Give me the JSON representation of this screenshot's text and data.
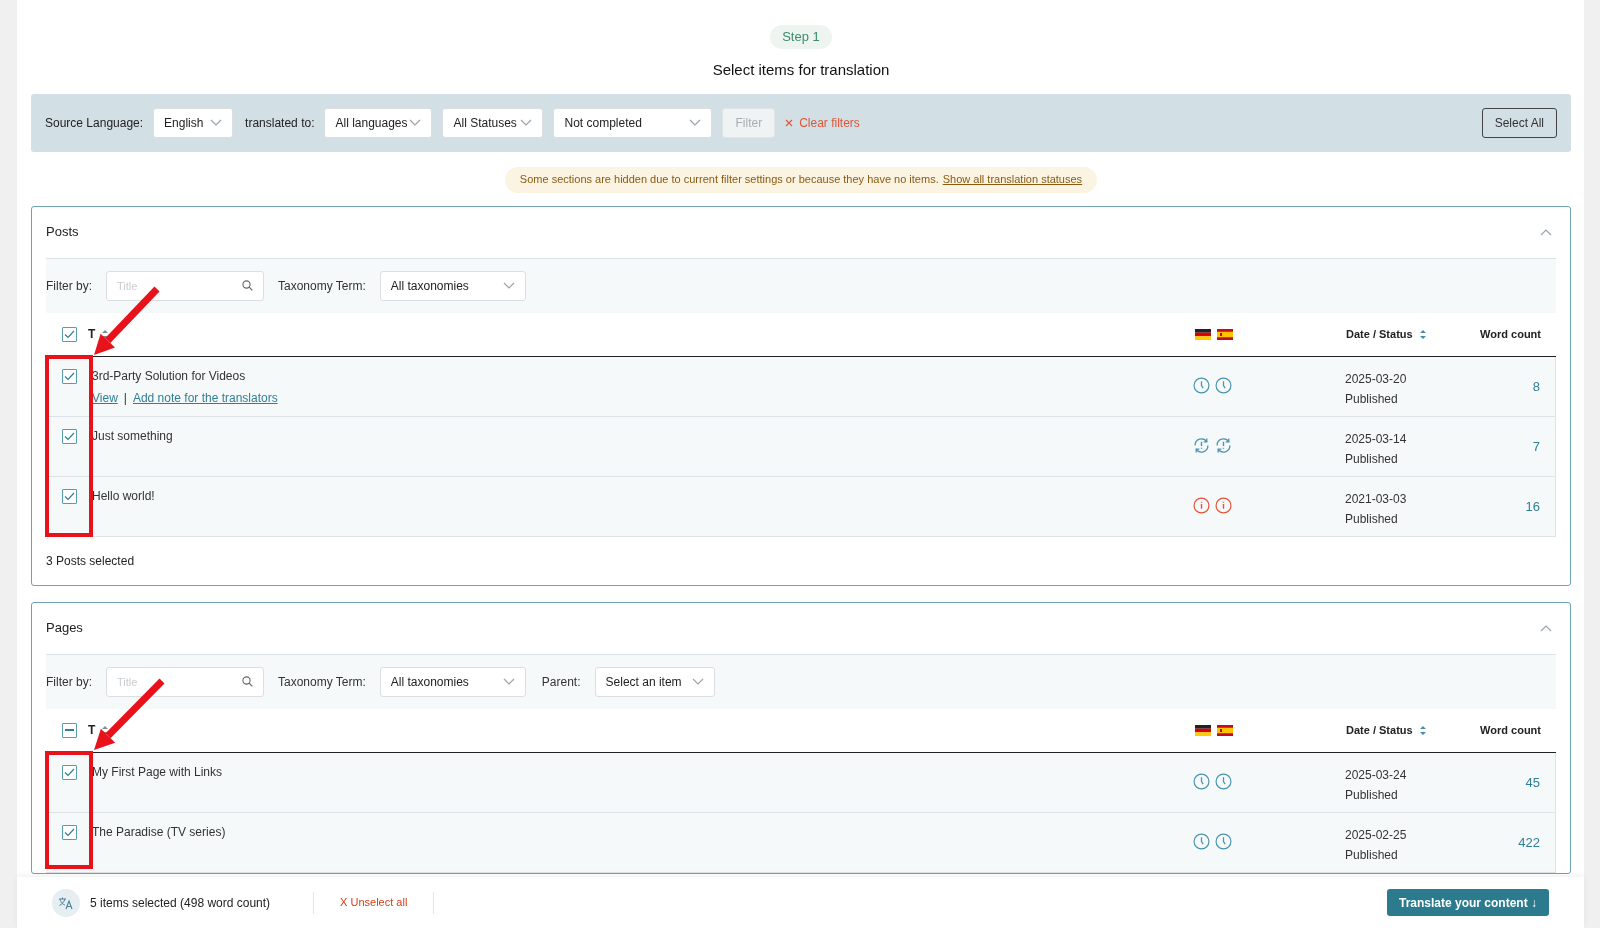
{
  "step": {
    "label": "Step 1",
    "title": "Select items for translation"
  },
  "filter_bar": {
    "source_label": "Source Language:",
    "source_value": "English",
    "translated_label": "translated to:",
    "languages": "All languages",
    "statuses": "All Statuses",
    "completion": "Not completed",
    "filter_button": "Filter",
    "clear": "Clear filters",
    "select_all": "Select All"
  },
  "notice": {
    "text": "Some sections are hidden due to current filter settings or because they have no items.",
    "link": "Show all translation statuses"
  },
  "sections": [
    {
      "title": "Posts",
      "expanded": true,
      "filter_label": "Filter by:",
      "title_placeholder": "Title",
      "taxonomy_label": "Taxonomy Term:",
      "taxonomy_value": "All taxonomies",
      "header_checkbox": {
        "checked": true
      },
      "columns": {
        "title": "T",
        "date": "Date / Status",
        "words": "Word count"
      },
      "languages": [
        {
          "kind": "de"
        },
        {
          "kind": "es"
        }
      ],
      "rows": [
        {
          "title": "3rd-Party Solution for Videos",
          "checked": true,
          "links": [
            "View",
            "Add note for the translators"
          ],
          "link_separator": "|",
          "statuses": [
            {
              "kind": "clock"
            },
            {
              "kind": "clock"
            }
          ],
          "date": "2025-03-20",
          "status": "Published",
          "words": "8"
        },
        {
          "title": "Just something",
          "checked": true,
          "statuses": [
            {
              "kind": "sync"
            },
            {
              "kind": "sync"
            }
          ],
          "date": "2025-03-14",
          "status": "Published",
          "words": "7"
        },
        {
          "title": "Hello world!",
          "checked": true,
          "statuses": [
            {
              "kind": "alert"
            },
            {
              "kind": "alert"
            }
          ],
          "date": "2021-03-03",
          "status": "Published",
          "words": "16"
        }
      ],
      "footer": "3 Posts selected"
    },
    {
      "title": "Pages",
      "expanded": true,
      "filter_label": "Filter by:",
      "title_placeholder": "Title",
      "taxonomy_label": "Taxonomy Term:",
      "taxonomy_value": "All taxonomies",
      "parent_label": "Parent:",
      "parent_value": "Select an item",
      "header_checkbox": {
        "indeterminate": true
      },
      "columns": {
        "title": "T",
        "date": "Date / Status",
        "words": "Word count"
      },
      "languages": [
        {
          "kind": "de"
        },
        {
          "kind": "es"
        }
      ],
      "rows": [
        {
          "title": "My First Page with Links",
          "checked": true,
          "statuses": [
            {
              "kind": "clock"
            },
            {
              "kind": "clock"
            }
          ],
          "date": "2025-03-24",
          "status": "Published",
          "words": "45"
        },
        {
          "title": "The Paradise (TV series)",
          "checked": true,
          "statuses": [
            {
              "kind": "clock"
            },
            {
              "kind": "clock"
            }
          ],
          "date": "2025-02-25",
          "status": "Published",
          "words": "422"
        }
      ]
    }
  ],
  "bottom_bar": {
    "summary": "5 items selected (498 word count)",
    "unselect": "X Unselect all",
    "translate": "Translate your content ↓"
  }
}
